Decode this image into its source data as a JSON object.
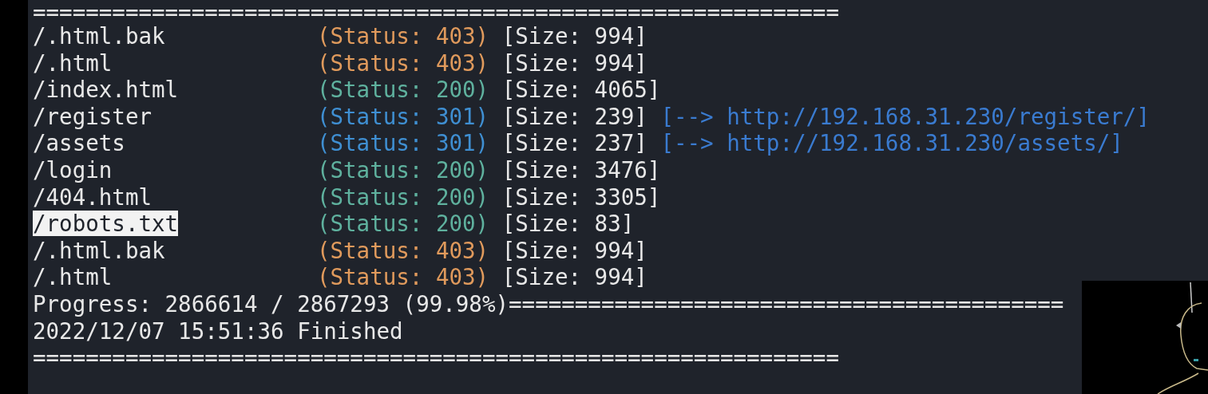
{
  "terminal": {
    "separator_top": "=============================================================",
    "results": [
      {
        "path": "/.html.bak",
        "highlighted": false,
        "status": "(Status: 403)",
        "color": "#e09a5c",
        "size": "[Size: 994]"
      },
      {
        "path": "/.html",
        "highlighted": false,
        "status": "(Status: 403)",
        "color": "#e09a5c",
        "size": "[Size: 994]"
      },
      {
        "path": "/index.html",
        "highlighted": false,
        "status": "(Status: 200)",
        "color": "#5fb19e",
        "size": "[Size: 4065]"
      },
      {
        "path": "/register",
        "highlighted": false,
        "status": "(Status: 301)",
        "color": "#3f8fd2",
        "size": "[Size: 239]",
        "redirect": "[--> http://192.168.31.230/register/]"
      },
      {
        "path": "/assets",
        "highlighted": false,
        "status": "(Status: 301)",
        "color": "#3f8fd2",
        "size": "[Size: 237]",
        "redirect": "[--> http://192.168.31.230/assets/]"
      },
      {
        "path": "/login",
        "highlighted": false,
        "status": "(Status: 200)",
        "color": "#5fb19e",
        "size": "[Size: 3476]"
      },
      {
        "path": "/404.html",
        "highlighted": false,
        "status": "(Status: 200)",
        "color": "#5fb19e",
        "size": "[Size: 3305]"
      },
      {
        "path": "/robots.txt",
        "highlighted": true,
        "status": "(Status: 200)",
        "color": "#5fb19e",
        "size": "[Size: 83]"
      },
      {
        "path": "/.html.bak",
        "highlighted": false,
        "status": "(Status: 403)",
        "color": "#e09a5c",
        "size": "[Size: 994]"
      },
      {
        "path": "/.html",
        "highlighted": false,
        "status": "(Status: 403)",
        "color": "#e09a5c",
        "size": "[Size: 994]"
      }
    ],
    "progress": "Progress: 2866614 / 2867293 (99.98%)==========================================",
    "finished": "2022/12/07 15:51:36 Finished",
    "separator_bottom": "============================================================="
  }
}
